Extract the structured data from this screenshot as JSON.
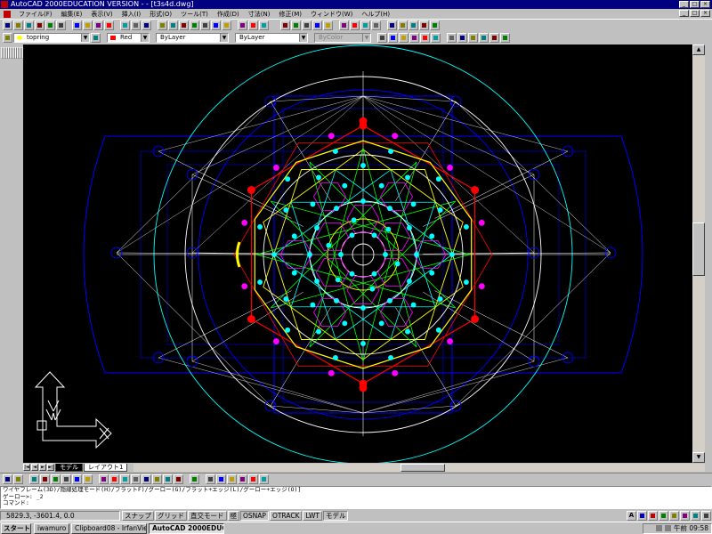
{
  "window": {
    "title": "AutoCAD 2000EDUCATION VERSION - - [t3s4d.dwg]",
    "controls": [
      "_",
      "□",
      "×"
    ]
  },
  "menu": {
    "items": [
      "ファイル(F)",
      "編集(E)",
      "表示(V)",
      "挿入(I)",
      "形式(O)",
      "ツール(T)",
      "作成(D)",
      "寸法(N)",
      "修正(M)",
      "ウィンドウ(W)",
      "ヘルプ(H)"
    ],
    "doc_controls": [
      "_",
      "□",
      "×"
    ]
  },
  "layers": {
    "current_layer": "topring",
    "color": "Red",
    "color_hex": "#ff0000",
    "linetype": "ByLayer",
    "lineweight": "ByLayer",
    "plotstyle": "ByColor"
  },
  "layout_tabs": {
    "nav": [
      "|◄",
      "◄",
      "►",
      "►|"
    ],
    "tabs": [
      "モデル",
      "レイアウト1"
    ]
  },
  "command": {
    "lines": [
      "ワイヤフレーム(3D)/隠線処理モード(H)/フラットF)/グーロー(G)/フラット+エッジ(L)/グーロー+エッジ(O)]",
      "ゲーロー>: _2",
      "コマンド:"
    ]
  },
  "status": {
    "coords": "5829.3,  -3601.4, 0.0",
    "buttons": [
      "スナップ",
      "グリッド",
      "直交モード",
      "極",
      "OSNAP",
      "OTRACK",
      "LWT",
      "モデル"
    ]
  },
  "taskbar": {
    "start": "スタート",
    "tasks": [
      "iwamuro",
      "Clipboard08 - IrfanView",
      "AutoCAD 2000EDUC..."
    ],
    "clock": "午前 09:58"
  },
  "colors": {
    "canvas": "#000000",
    "blue": "#0000ff",
    "red": "#ff0000",
    "cyan": "#00ffff",
    "yellow": "#ffff00",
    "magenta": "#ff00ff",
    "green": "#00ff00",
    "white": "#ffffff"
  },
  "icons": {
    "toolbar_standard": [
      "new-icon",
      "open-icon",
      "save-icon",
      "print-icon",
      "preview-icon",
      "spell-icon",
      "cut-icon",
      "copy-icon",
      "paste-icon",
      "matchprop-icon",
      "undo-icon",
      "redo-icon",
      "hyperlink-icon",
      "osnap-icon",
      "ucs-icon",
      "pan-icon",
      "zoom-realtime-icon",
      "zoom-window-icon",
      "zoom-previous-icon",
      "aerial-view-icon",
      "properties-icon",
      "design-center-icon",
      "help-icon"
    ],
    "toolbar_render": [
      "hide-icon",
      "render-icon",
      "scenes-icon",
      "lights-icon",
      "materials-icon",
      "library-icon",
      "mapping-icon",
      "background-icon",
      "fog-icon",
      "landscape-icon",
      "landscape-edit-icon",
      "landscape-library-icon",
      "render-prefs-icon",
      "statistics-icon"
    ],
    "draw_tools": [
      "line-icon",
      "xline-icon",
      "polyline-icon",
      "polygon-icon",
      "rectangle-icon",
      "arc-icon",
      "circle-icon",
      "spline-icon",
      "ellipse-icon",
      "insert-block-icon",
      "make-block-icon",
      "point-icon",
      "hatch-icon",
      "region-icon",
      "mtext-icon"
    ],
    "modify_tools": [
      "erase-icon",
      "copy-object-icon",
      "mirror-icon",
      "offset-icon",
      "array-icon",
      "move-icon",
      "rotate-icon",
      "scale-icon",
      "stretch-icon",
      "lengthen-icon",
      "trim-icon",
      "extend-icon",
      "break-icon",
      "chamfer-icon",
      "fillet-icon",
      "explode-icon"
    ],
    "view_tools": [
      "top-view-icon",
      "bottom-view-icon",
      "left-view-icon",
      "right-view-icon",
      "front-view-icon",
      "back-view-icon",
      "sw-iso-icon",
      "se-iso-icon",
      "ne-iso-icon",
      "nw-iso-icon",
      "shade-icon",
      "shade-gouraud-icon"
    ],
    "ucs_icon": "ucs-wcs-icon"
  }
}
